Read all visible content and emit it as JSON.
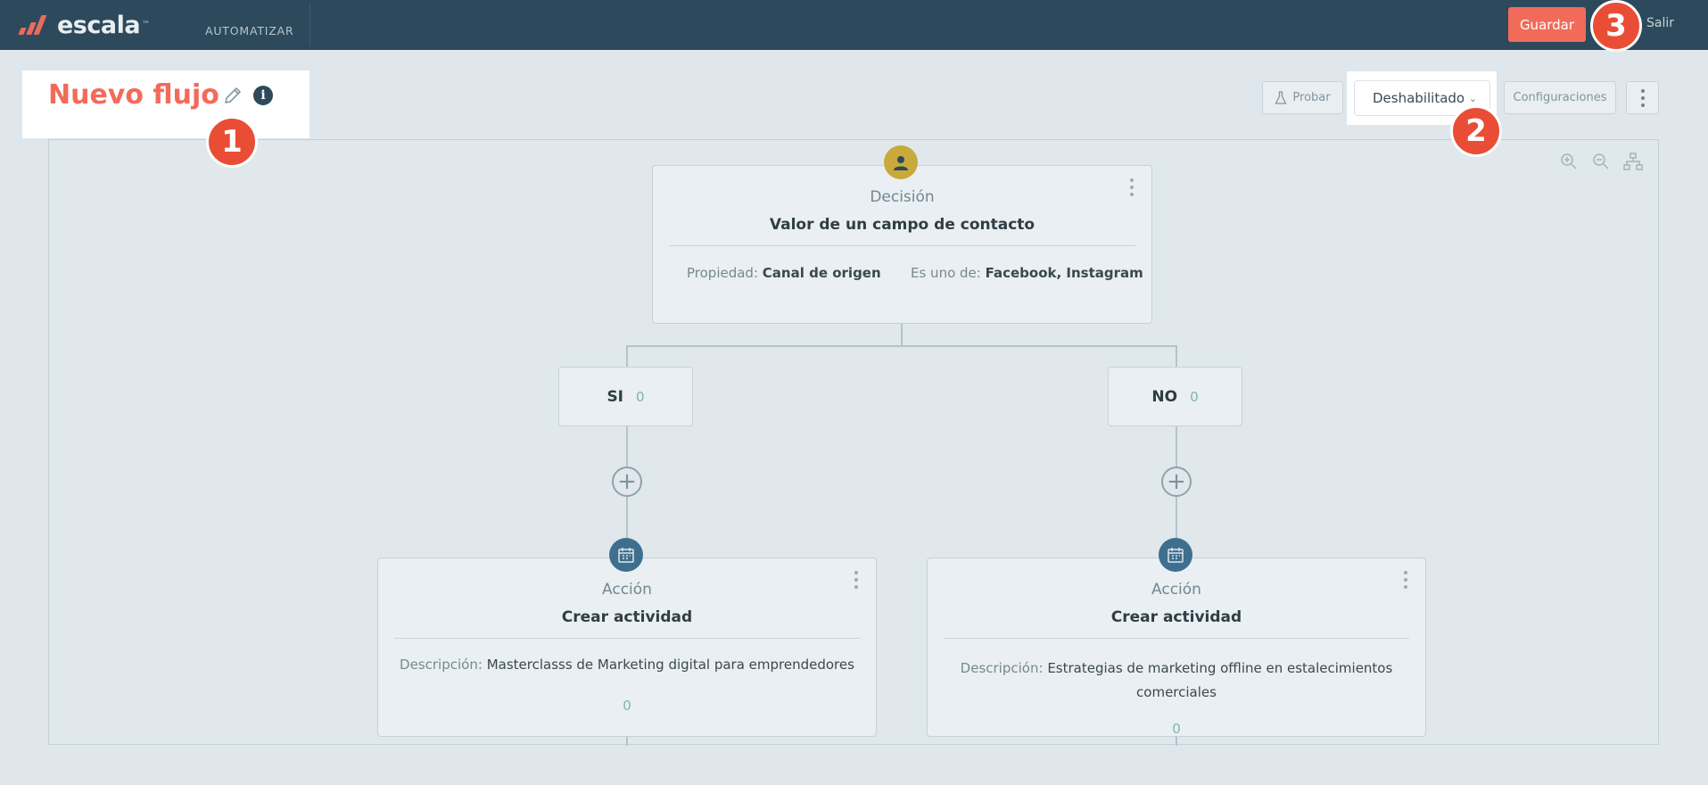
{
  "app": {
    "logo_text": "escala",
    "logo_tm": "™",
    "nav": "AUTOMATIZAR",
    "save_label": "Guardar",
    "exit_label": "Salir"
  },
  "badges": [
    "1",
    "2",
    "3"
  ],
  "flow": {
    "title": "Nuevo flujo"
  },
  "toolbar": {
    "test_label": "Probar",
    "status_value": "Deshabilitado",
    "settings_label": "Configuraciones"
  },
  "decision": {
    "type": "Decisión",
    "title": "Valor de un campo de contacto",
    "property_label": "Propiedad:",
    "property_value": "Canal de origen",
    "condition_label": "Es uno de:",
    "condition_value": "Facebook, Instagram"
  },
  "branches": [
    {
      "label": "SI",
      "count": "0"
    },
    {
      "label": "NO",
      "count": "0"
    }
  ],
  "actions": [
    {
      "type": "Acción",
      "title": "Crear actividad",
      "desc_label": "Descripción:",
      "desc_value": "Masterclasss de Marketing digital para emprendedores",
      "count": "0"
    },
    {
      "type": "Acción",
      "title": "Crear actividad",
      "desc_label": "Descripción:",
      "desc_value": "Estrategias de marketing offline en estalecimientos",
      "desc_value_2": "comerciales",
      "count": "0"
    }
  ],
  "colors": {
    "topbar": "#2c4a5c",
    "accent": "#f26b5a",
    "badge": "#ea4d35",
    "decision_icon": "#c9a93a",
    "action_icon": "#3f6f8e"
  }
}
